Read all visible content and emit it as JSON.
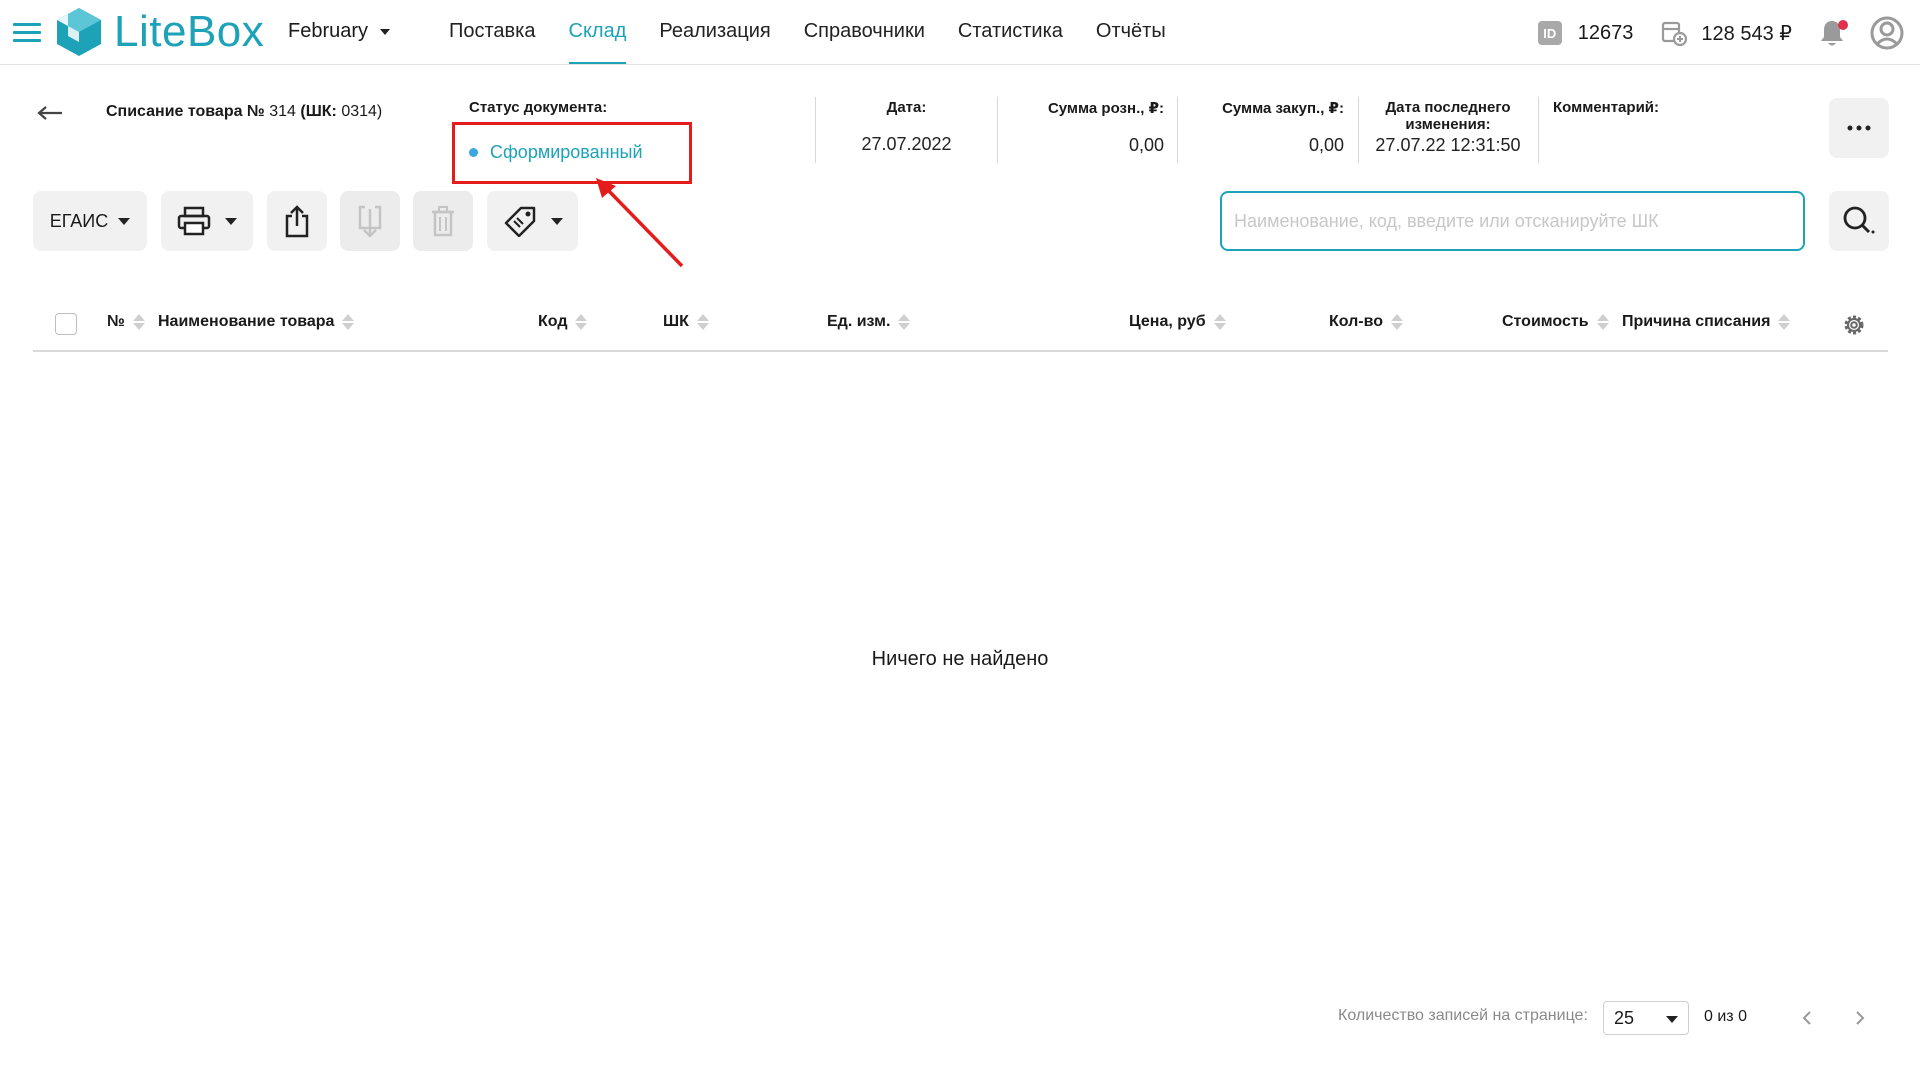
{
  "app": {
    "logo_text": "LiteBox",
    "store": "February"
  },
  "nav": {
    "items": [
      {
        "label": "Поставка"
      },
      {
        "label": "Склад"
      },
      {
        "label": "Реализация"
      },
      {
        "label": "Справочники"
      },
      {
        "label": "Статистика"
      },
      {
        "label": "Отчёты"
      }
    ],
    "active": "Склад"
  },
  "account": {
    "id_badge": "ID",
    "id_value": "12673",
    "balance": "128 543 ₽"
  },
  "document": {
    "title_prefix": "Списание товара №",
    "title_number": " 314 ",
    "title_code_label": "(ШК: ",
    "title_code": "0314)",
    "status_label": "Статус документа:",
    "status_value": "Сформированный",
    "date_label": "Дата:",
    "date_value": "27.07.2022",
    "retail_label": "Сумма розн., ₽:",
    "retail_value": "0,00",
    "purchase_label": "Сумма закуп., ₽:",
    "purchase_value": "0,00",
    "modified_label_1": "Дата последнего",
    "modified_label_2": "изменения:",
    "modified_value": "27.07.22 12:31:50",
    "comment_label": "Комментарий:"
  },
  "toolbar": {
    "egais_label": "ЕГАИС",
    "search_placeholder": "Наименование, код, введите или отсканируйте ШК"
  },
  "table": {
    "columns": [
      {
        "label": "№"
      },
      {
        "label": "Наименование товара"
      },
      {
        "label": "Код"
      },
      {
        "label": "ШК"
      },
      {
        "label": "Ед. изм."
      },
      {
        "label": "Цена, руб"
      },
      {
        "label": "Кол-во"
      },
      {
        "label": "Стоимость"
      },
      {
        "label": "Причина списания"
      }
    ],
    "empty_message": "Ничего не найдено"
  },
  "pagination": {
    "per_page_label": "Количество записей на странице:",
    "per_page_value": "25",
    "count_text": "0 из 0"
  },
  "colors": {
    "accent": "#1da2b8",
    "highlight": "#e51c1c",
    "status_dot": "#3ba7e0",
    "notification_dot": "#e0304e"
  },
  "icons": [
    "hamburger-icon",
    "logo-icon",
    "id-icon",
    "balance-icon",
    "bell-icon",
    "avatar-icon",
    "back-arrow-icon",
    "more-icon",
    "printer-icon",
    "export-icon",
    "import-icon",
    "trash-icon",
    "price-tag-icon",
    "search-icon",
    "gear-icon",
    "chevron-left-icon",
    "chevron-right-icon"
  ]
}
